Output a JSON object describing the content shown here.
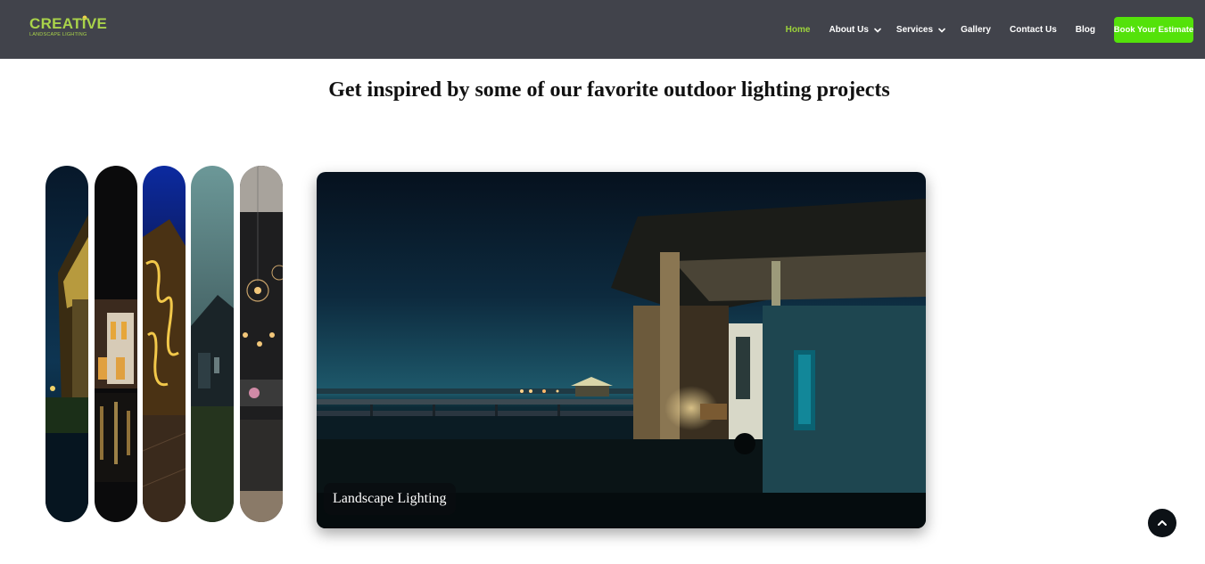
{
  "brand": {
    "name": "CREATIVE",
    "tagline": "LANDSCAPE LIGHTING",
    "color": "#a9d34a"
  },
  "nav": {
    "items": [
      {
        "label": "Home",
        "active": true
      },
      {
        "label": "About Us",
        "dropdown": true
      },
      {
        "label": "Services",
        "dropdown": true
      },
      {
        "label": "Gallery"
      },
      {
        "label": "Contact Us"
      },
      {
        "label": "Blog"
      }
    ],
    "cta_label": "Book Your Estimate",
    "cta_color": "#54e20a",
    "active_color": "#9cd33a"
  },
  "gallery": {
    "heading": "Get inspired by some of our favorite outdoor lighting projects",
    "featured_label": "Landscape Lighting",
    "thumbnails": [
      {
        "name": "thumb-1",
        "scene": "lit-pavilion-night"
      },
      {
        "name": "thumb-2",
        "scene": "mansion-reflection"
      },
      {
        "name": "thumb-3",
        "scene": "ornate-lit-arch"
      },
      {
        "name": "thumb-4",
        "scene": "house-dusk"
      },
      {
        "name": "thumb-5",
        "scene": "pendant-lights-interior"
      }
    ]
  },
  "icons": {
    "dropdown": "chevron-down-icon",
    "scroll_top": "chevron-up-icon"
  }
}
